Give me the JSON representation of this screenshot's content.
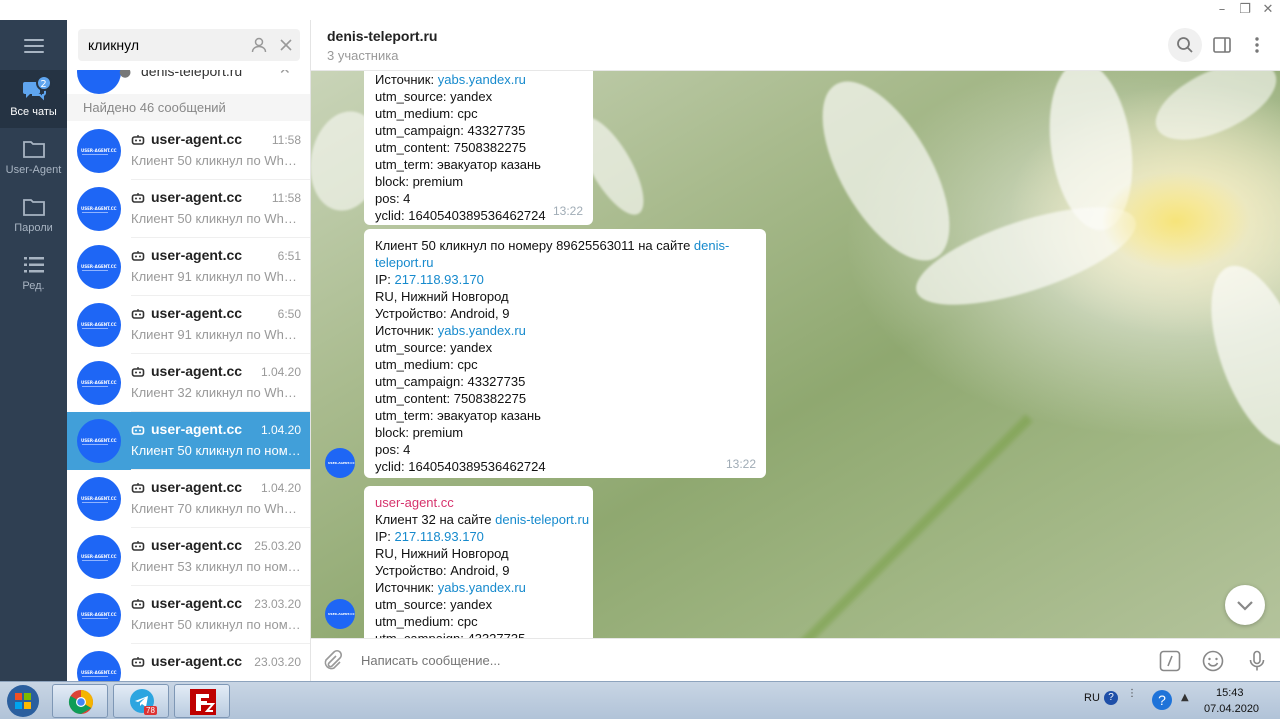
{
  "sidebar_rail": {
    "items": [
      {
        "label": "Все чаты",
        "badge": "2"
      },
      {
        "label": "User-Agent"
      },
      {
        "label": "Пароли"
      },
      {
        "label": "Ред."
      }
    ]
  },
  "search": {
    "value": "кликнул"
  },
  "pinned": {
    "name": "denis-teleport.ru"
  },
  "found_label": "Найдено 46 сообщений",
  "results": [
    {
      "name": "user-agent.cc",
      "time": "11:58",
      "preview": "Клиент 50 кликнул по WhatsApp"
    },
    {
      "name": "user-agent.cc",
      "time": "11:58",
      "preview": "Клиент 50 кликнул по WhatsApp"
    },
    {
      "name": "user-agent.cc",
      "time": "6:51",
      "preview": "Клиент 91 кликнул по WhatsApp"
    },
    {
      "name": "user-agent.cc",
      "time": "6:50",
      "preview": "Клиент 91 кликнул по WhatsApp"
    },
    {
      "name": "user-agent.cc",
      "time": "1.04.20",
      "preview": "Клиент 32 кликнул по WhatsApp"
    },
    {
      "name": "user-agent.cc",
      "time": "1.04.20",
      "preview": "Клиент 50 кликнул по номеру"
    },
    {
      "name": "user-agent.cc",
      "time": "1.04.20",
      "preview": "Клиент 70 кликнул по WhatsApp"
    },
    {
      "name": "user-agent.cc",
      "time": "25.03.20",
      "preview": "Клиент 53 кликнул по номеру"
    },
    {
      "name": "user-agent.cc",
      "time": "23.03.20",
      "preview": "Клиент 50 кликнул по номеру"
    },
    {
      "name": "user-agent.cc",
      "time": "23.03.20",
      "preview": ""
    }
  ],
  "avatar_text": "USER-AGENT.CC",
  "conversation": {
    "title": "denis-teleport.ru",
    "subtitle": "3 участника"
  },
  "messages": {
    "m1": {
      "source_label": "Источник: ",
      "source_link": "yabs.yandex.ru",
      "lines": [
        "utm_source: yandex",
        "utm_medium: cpc",
        "utm_campaign: 43327735",
        "utm_content: 7508382275",
        "utm_term: эвакуатор казань",
        "block: premium",
        "pos: 4",
        "yclid: 1640540389536462724"
      ],
      "time": "13:22"
    },
    "m2": {
      "intro": "Клиент 50 кликнул по номеру 89625563011 на сайте ",
      "site_link_a": "denis-",
      "site_link_b": "teleport.ru",
      "ip_label": "IP: ",
      "ip_link": "217.118.93.170",
      "lines_a": [
        "RU, Нижний Новгород",
        "Устройство: Android, 9"
      ],
      "source_label": "Источник: ",
      "source_link": "yabs.yandex.ru",
      "lines_b": [
        "utm_source: yandex",
        "utm_medium: cpc",
        "utm_campaign: 43327735",
        "utm_content: 7508382275",
        "utm_term: эвакуатор казань",
        "block: premium",
        "pos: 4",
        "yclid: 1640540389536462724"
      ],
      "time": "13:22"
    },
    "m3": {
      "sender": "user-agent.cc",
      "intro": "Клиент 32 на сайте ",
      "site_link": "denis-teleport.ru",
      "ip_label": "IP: ",
      "ip_link": "217.118.93.170",
      "lines_a": [
        "RU, Нижний Новгород",
        "Устройство: Android, 9"
      ],
      "source_label": "Источник: ",
      "source_link": "yabs.yandex.ru",
      "lines_b": [
        "utm_source: yandex",
        "utm_medium: cpc",
        "utm_campaign: 43327735"
      ]
    }
  },
  "composer": {
    "placeholder": "Написать сообщение..."
  },
  "taskbar": {
    "telegram_badge": "78",
    "lang": "RU",
    "clock_time": "15:43",
    "clock_date": "07.04.2020"
  },
  "colors": {
    "accent": "#419fd9",
    "rail": "#2f3f52",
    "link": "#168acd",
    "sender": "#d6336c"
  }
}
